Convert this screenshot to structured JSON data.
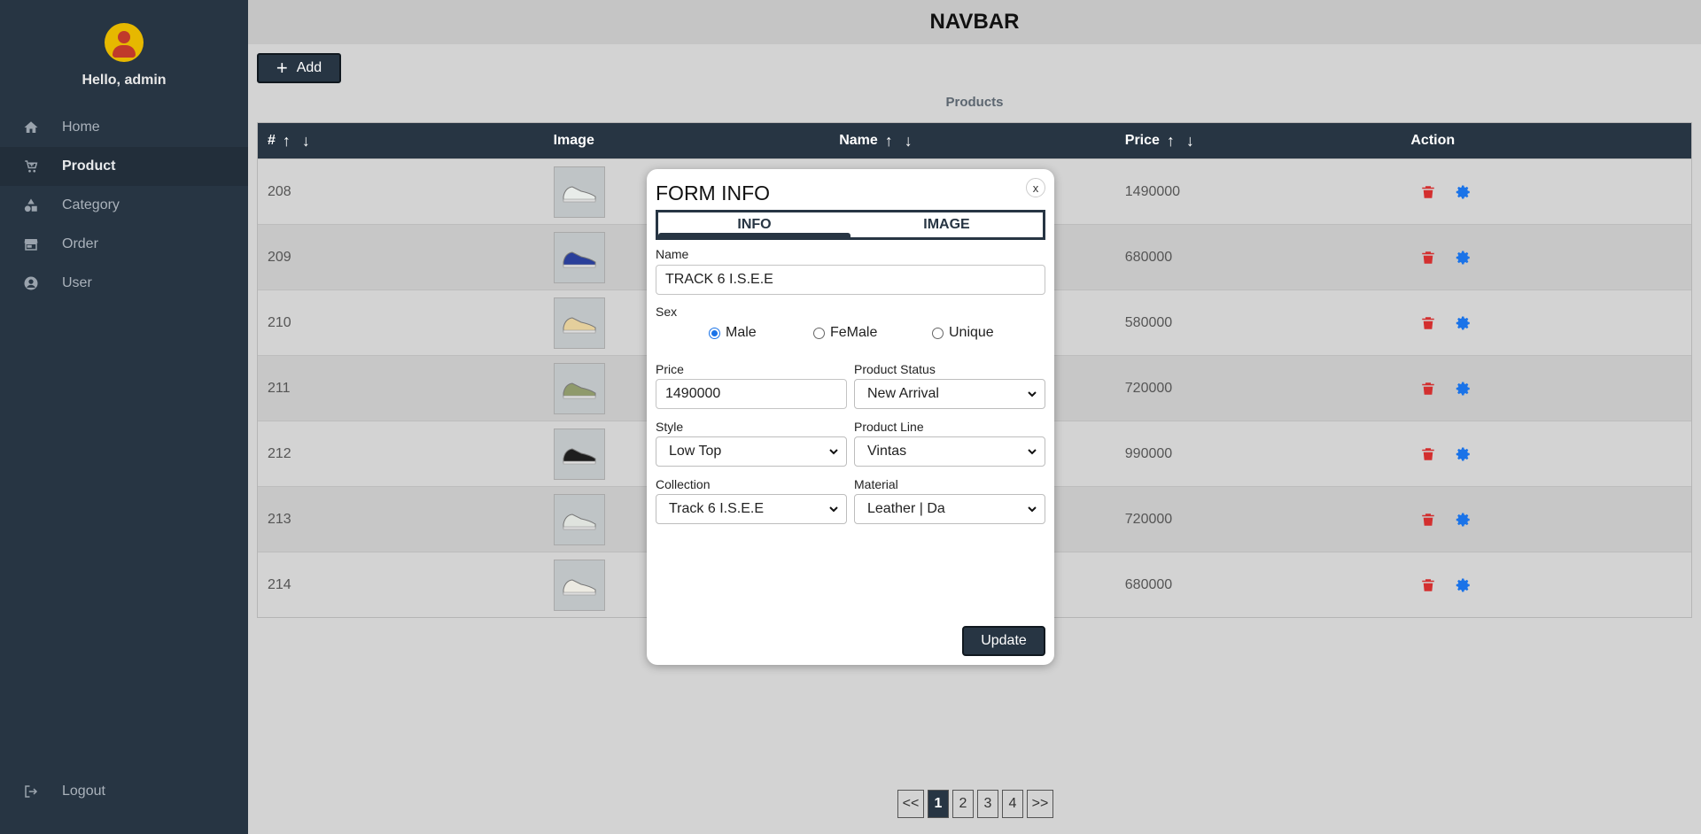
{
  "sidebar": {
    "greeting": "Hello, admin",
    "items": [
      {
        "label": "Home",
        "icon": "home-icon"
      },
      {
        "label": "Product",
        "icon": "cart-icon",
        "active": true
      },
      {
        "label": "Category",
        "icon": "shapes-icon"
      },
      {
        "label": "Order",
        "icon": "store-icon"
      },
      {
        "label": "User",
        "icon": "user-circle-icon"
      }
    ],
    "logout": "Logout"
  },
  "navbar": {
    "title": "NAVBAR"
  },
  "toolbar": {
    "add_label": "Add"
  },
  "table": {
    "caption": "Products",
    "headers": {
      "id": "#",
      "image": "Image",
      "name": "Name",
      "price": "Price",
      "action": "Action"
    },
    "sort_arrows": "↑ ↓",
    "rows": [
      {
        "id": "208",
        "price": "1490000"
      },
      {
        "id": "209",
        "price": "680000"
      },
      {
        "id": "210",
        "price": "580000"
      },
      {
        "id": "211",
        "price": "720000"
      },
      {
        "id": "212",
        "price": "990000"
      },
      {
        "id": "213",
        "price": "720000"
      },
      {
        "id": "214",
        "price": "680000"
      }
    ]
  },
  "pagination": {
    "prev": "<<",
    "pages": [
      "1",
      "2",
      "3",
      "4"
    ],
    "next": ">>",
    "current": "1"
  },
  "modal": {
    "title": "FORM INFO",
    "close": "x",
    "tabs": [
      "INFO",
      "IMAGE"
    ],
    "active_tab": "INFO",
    "name_label": "Name",
    "name_value": "TRACK 6 I.S.E.E",
    "sex_label": "Sex",
    "sex_options": [
      "Male",
      "FeMale",
      "Unique"
    ],
    "sex_selected": "Male",
    "price_label": "Price",
    "price_value": "1490000",
    "status_label": "Product Status",
    "status_value": "New Arrival",
    "style_label": "Style",
    "style_value": "Low Top",
    "line_label": "Product Line",
    "line_value": "Vintas",
    "collection_label": "Collection",
    "collection_value": "Track 6 I.S.E.E",
    "material_label": "Material",
    "material_value": "Leather | Da",
    "update_label": "Update"
  },
  "colors": {
    "sidebar": "#273543",
    "accent_blue": "#1a73e8",
    "delete_red": "#d32f2f",
    "avatar_yellow": "#e6b800"
  }
}
